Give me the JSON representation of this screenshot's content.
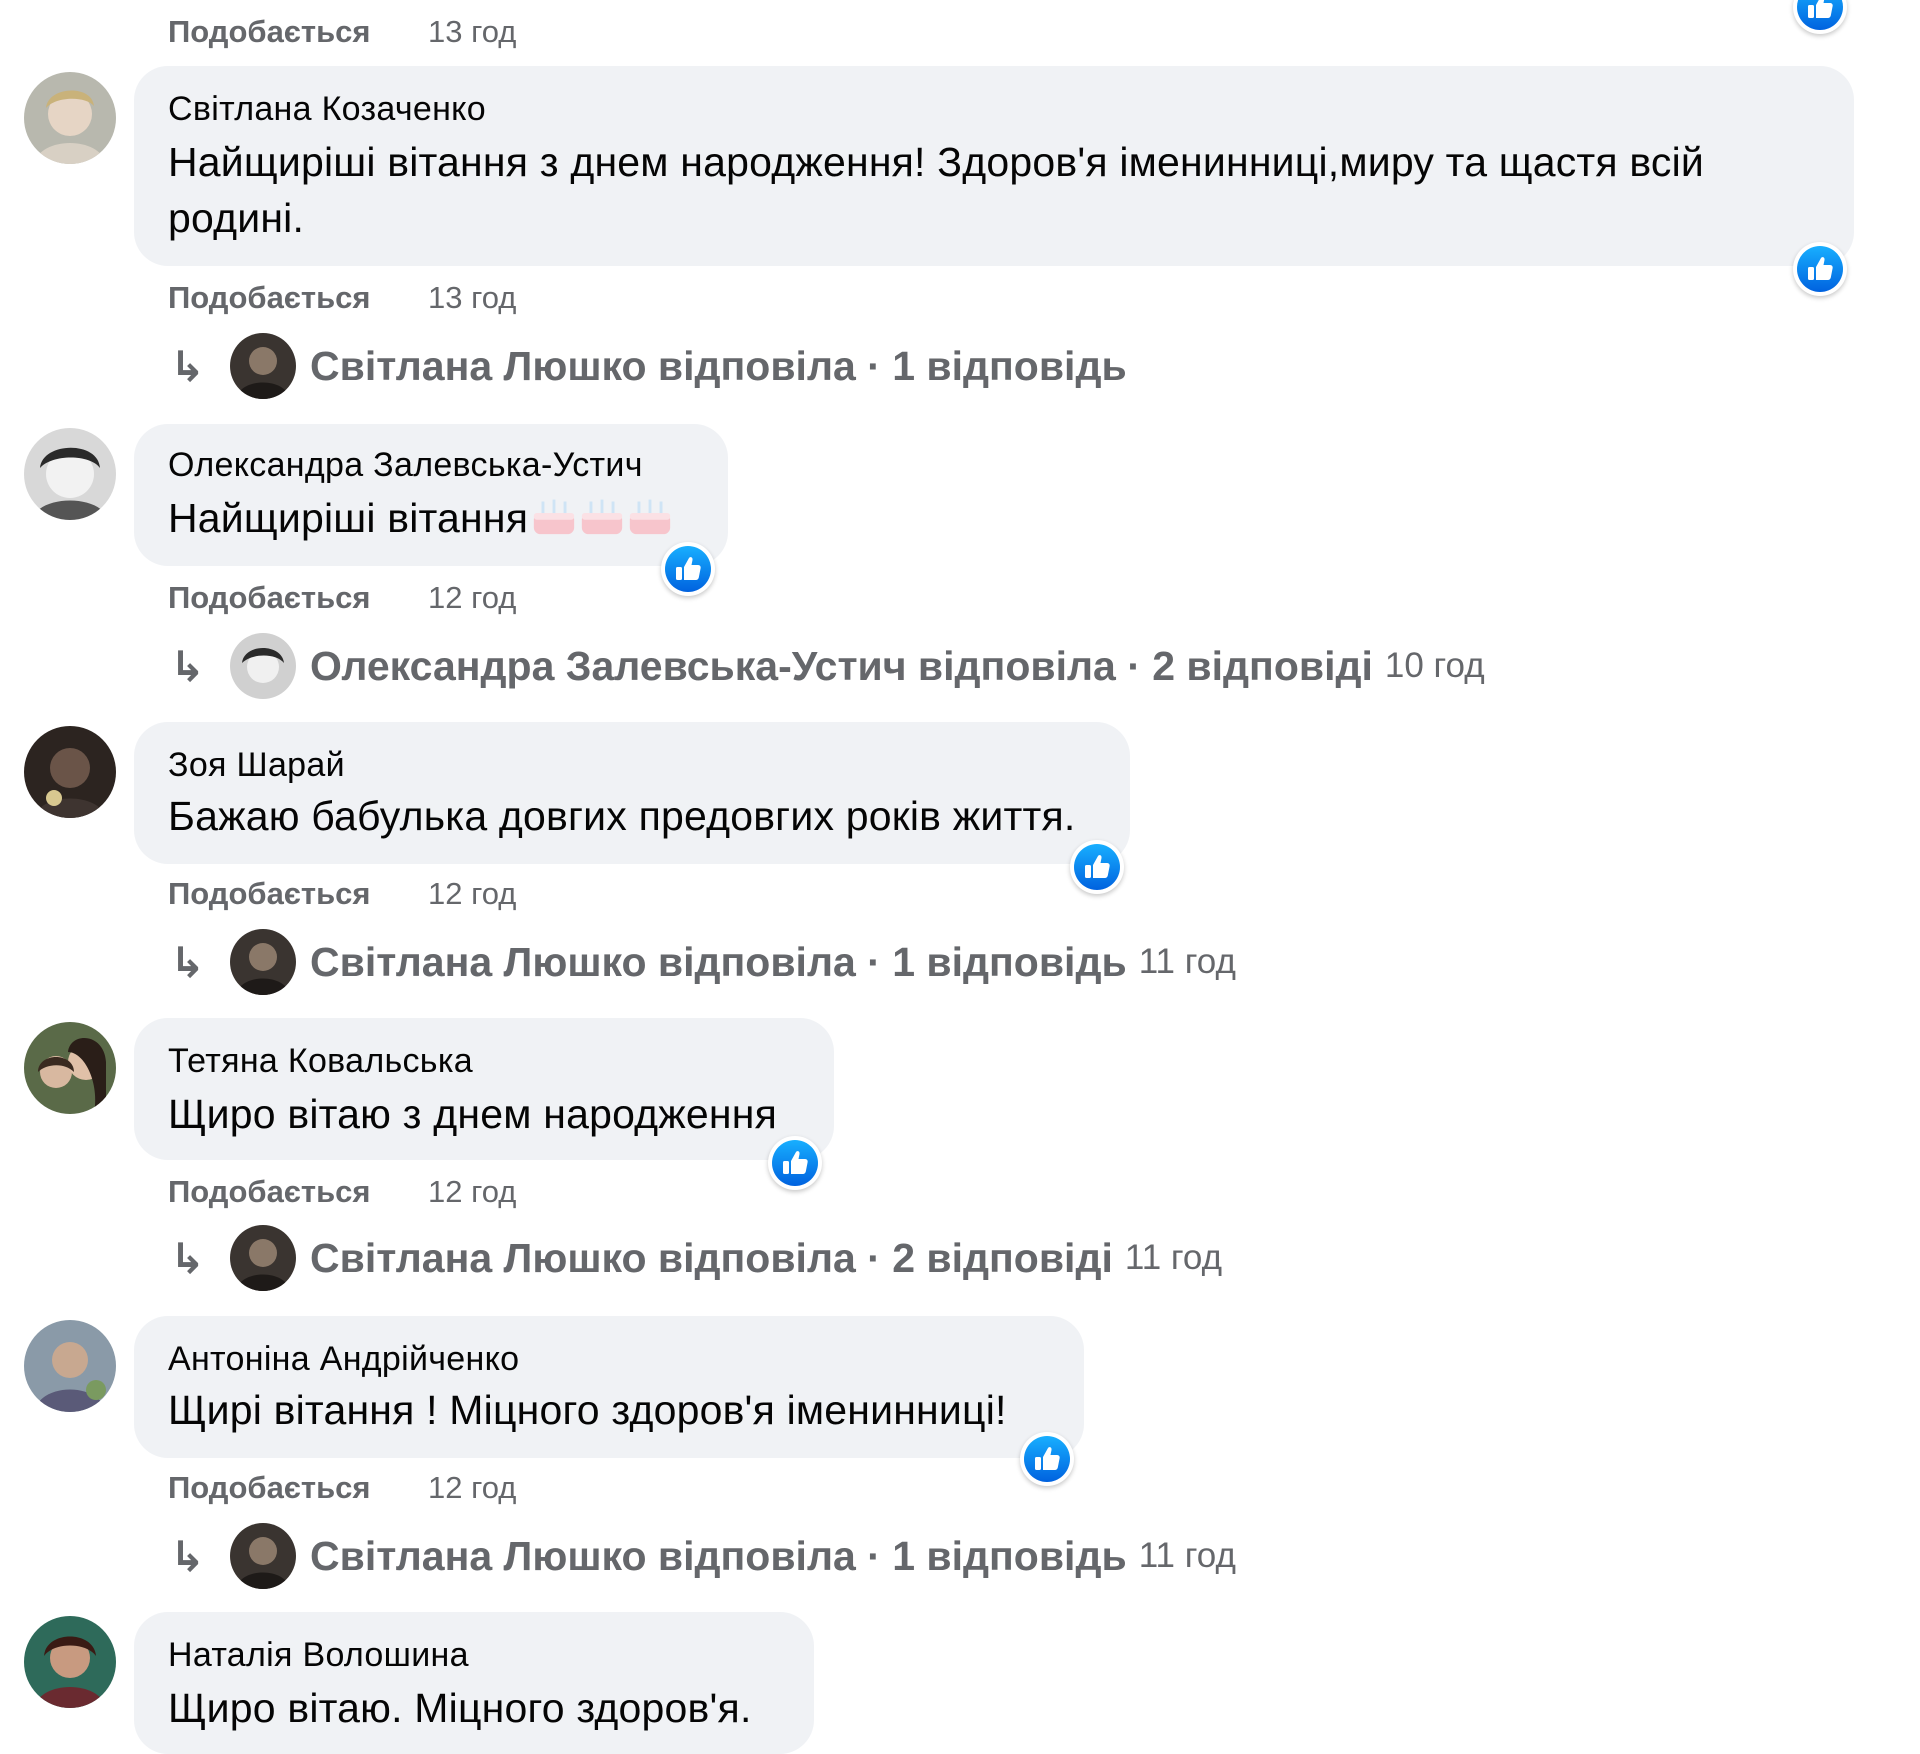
{
  "comments": [
    {
      "like_label": "Подобається",
      "time": "13 год"
    },
    {
      "author": "Світлана Козаченко",
      "text_line1": "Найщиріші вітання з днем народження! Здоров'я іменинниці,миру та щастя всій",
      "text_line2": "родині.",
      "like_label": "Подобається",
      "time": "13 год",
      "reply": {
        "summary": "Світлана Люшко відповіла · 1 відповідь",
        "time": ""
      }
    },
    {
      "author": "Олександра Залевська-Устич",
      "text": "Найщиріші вітання",
      "like_label": "Подобається",
      "time": "12 год",
      "reply": {
        "summary": "Олександра Залевська-Устич відповіла · 2 відповіді",
        "time": "10 год"
      }
    },
    {
      "author": "Зоя Шарай",
      "text": "Бажаю бабулька довгих предовгих років життя.",
      "like_label": "Подобається",
      "time": "12 год",
      "reply": {
        "summary": "Світлана Люшко відповіла · 1 відповідь",
        "time": "11 год"
      }
    },
    {
      "author": "Тетяна Ковальська",
      "text": "Щиро вітаю з днем народження",
      "like_label": "Подобається",
      "time": "12 год",
      "reply": {
        "summary": "Світлана Люшко відповіла · 2 відповіді",
        "time": "11 год"
      }
    },
    {
      "author": "Антоніна Андрійченко",
      "text": "Щирі вітання ! Міцного здоров'я іменинниці!",
      "like_label": "Подобається",
      "time": "12 год",
      "reply": {
        "summary": "Світлана Люшко відповіла · 1 відповідь",
        "time": "11 год"
      }
    },
    {
      "author": "Наталія Волошина",
      "text": "Щиро вітаю. Міцного здоров'я."
    }
  ],
  "icons": {
    "like": "like-thumb-icon",
    "reply": "reply-arrow-icon",
    "cake": "birthday-cake-emoji"
  },
  "colors": {
    "bubble": "#f0f2f5",
    "like_blue": "#1877f2",
    "meta_gray": "#65676b",
    "text": "#050505"
  }
}
